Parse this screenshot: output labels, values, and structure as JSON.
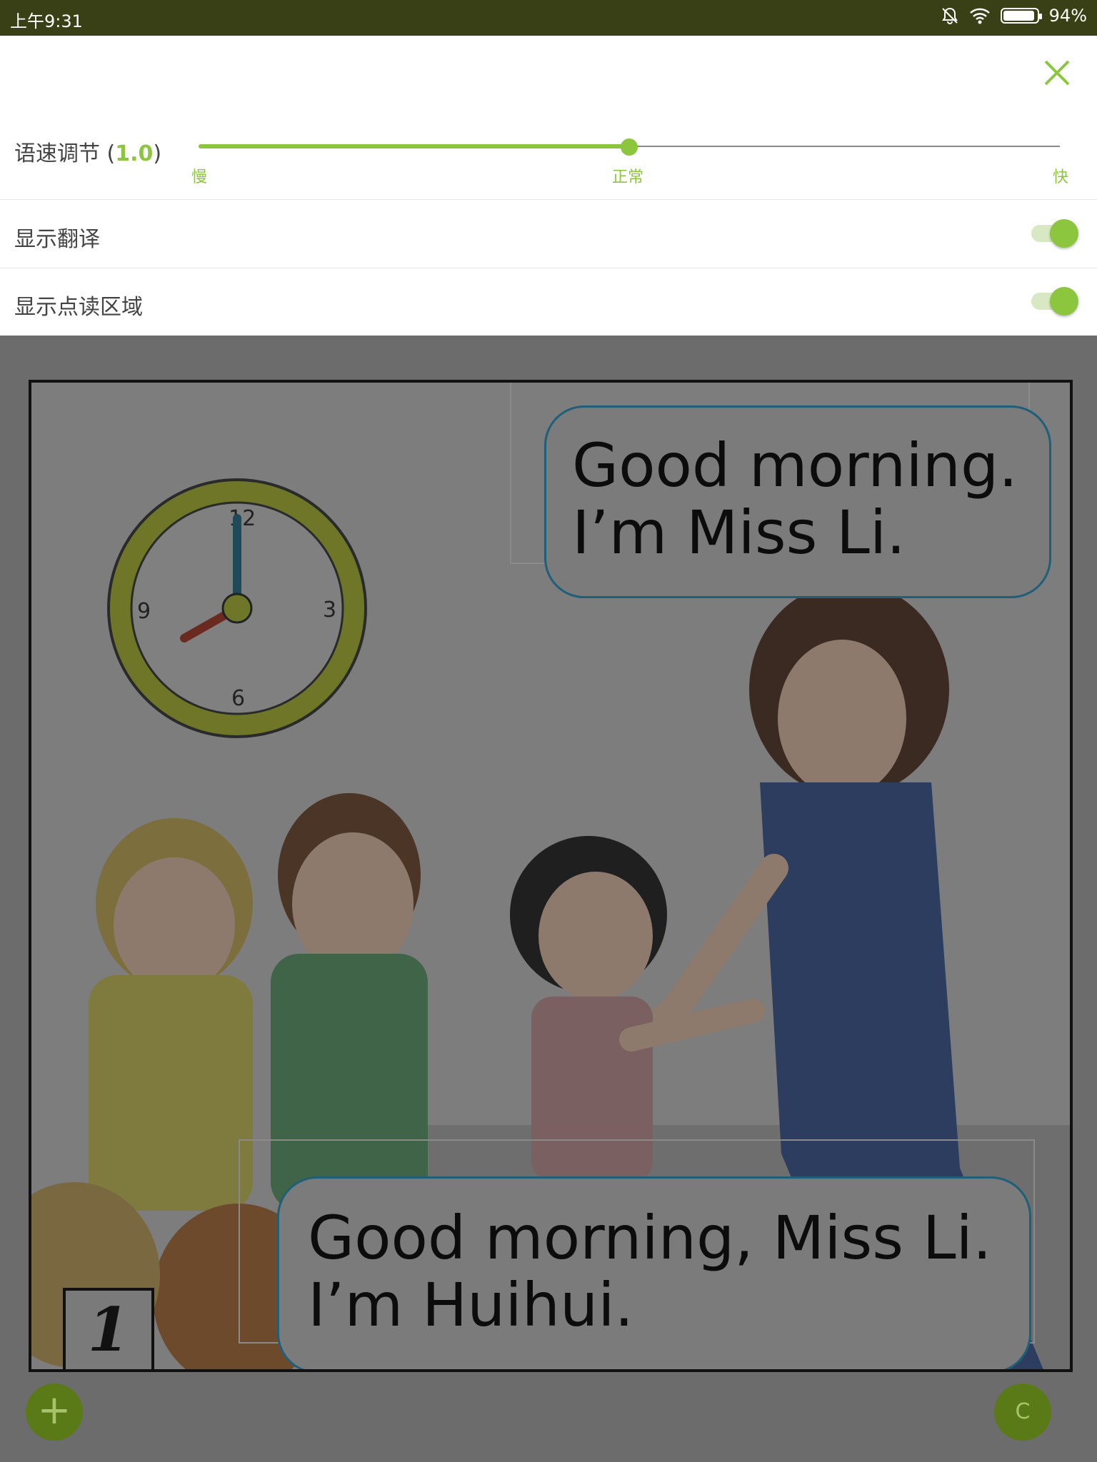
{
  "status_bar": {
    "time": "上午9:31",
    "battery": "94%",
    "battery_level": 0.94
  },
  "settings": {
    "speed": {
      "label": "语速调节",
      "value": "1.0",
      "level": 0.5,
      "ticks": {
        "slow": "慢",
        "normal": "正常",
        "fast": "快"
      }
    },
    "show_translation": {
      "label": "显示翻译",
      "on": true
    },
    "show_read_area": {
      "label": "显示点读区域",
      "on": true
    }
  },
  "page": {
    "number": "1",
    "bubbles": [
      {
        "line1": "Good morning.",
        "line2": "I’m Miss Li."
      },
      {
        "line1": "Good morning, Miss Li.",
        "line2": "I’m Huihui."
      }
    ]
  },
  "fab": {
    "add": "+",
    "right": "C"
  },
  "colors": {
    "accent": "#8cc63f",
    "status_bar": "#3a4015"
  }
}
